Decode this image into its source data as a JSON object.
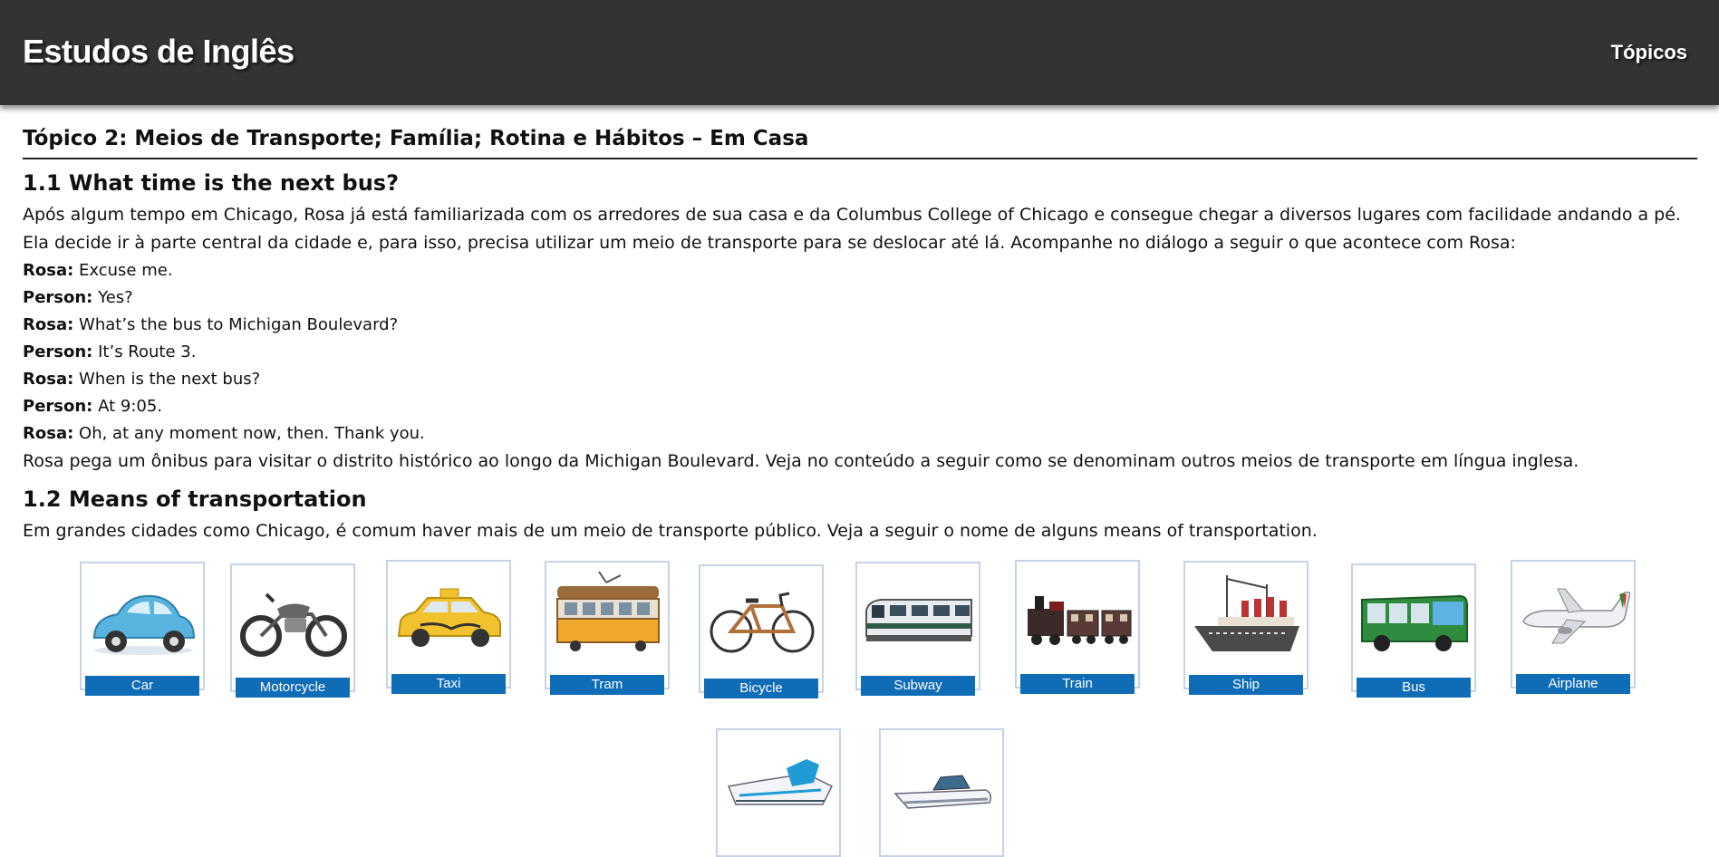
{
  "header": {
    "site_title": "Estudos de Inglês",
    "topics_link": "Tópicos"
  },
  "topic": {
    "title": "Tópico 2: Meios de Transporte; Família; Rotina e Hábitos – Em Casa"
  },
  "section1": {
    "heading": "1.1 What time is the next bus?",
    "intro": "Após algum tempo em Chicago, Rosa já está familiarizada com os arredores de sua casa e da Columbus College of Chicago e consegue chegar a diversos lugares com facilidade andando a pé. Ela decide ir à parte central da cidade e, para isso, precisa utilizar um meio de transporte para se deslocar até lá. Acompanhe no diálogo a seguir o que acontece com Rosa:",
    "dialog": [
      {
        "speaker": "Rosa:",
        "line": "Excuse me."
      },
      {
        "speaker": "Person:",
        "line": "Yes?"
      },
      {
        "speaker": "Rosa:",
        "line": "What’s the bus to Michigan Boulevard?"
      },
      {
        "speaker": "Person:",
        "line": "It’s Route 3."
      },
      {
        "speaker": "Rosa:",
        "line": "When is the next bus?"
      },
      {
        "speaker": "Person:",
        "line": "At 9:05."
      },
      {
        "speaker": "Rosa:",
        "line": "Oh, at any moment now, then. Thank you."
      }
    ],
    "outro": "Rosa pega um ônibus para visitar o distrito histórico ao longo da Michigan Boulevard. Veja no conteúdo a seguir como se denominam outros meios de transporte em língua inglesa."
  },
  "section2": {
    "heading": "1.2 Means of transportation",
    "intro": "Em grandes cidades como Chicago, é comum haver mais de um meio de transporte público. Veja a seguir o nome de alguns means of transportation."
  },
  "transport_cards": [
    {
      "label": "Car",
      "icon": "car-icon"
    },
    {
      "label": "Motorcycle",
      "icon": "motorcycle-icon"
    },
    {
      "label": "Taxi",
      "icon": "taxi-icon"
    },
    {
      "label": "Tram",
      "icon": "tram-icon"
    },
    {
      "label": "Bicycle",
      "icon": "bicycle-icon"
    },
    {
      "label": "Subway",
      "icon": "subway-icon"
    },
    {
      "label": "Train",
      "icon": "train-icon"
    },
    {
      "label": "Ship",
      "icon": "ship-icon"
    },
    {
      "label": "Bus",
      "icon": "bus-icon"
    },
    {
      "label": "Airplane",
      "icon": "airplane-icon"
    },
    {
      "label": "",
      "icon": "ferry-icon"
    },
    {
      "label": "",
      "icon": "speedboat-icon"
    }
  ],
  "colors": {
    "header_bg": "#333333",
    "caption_bg": "#0f6db8",
    "card_border": "#c6d3e6"
  }
}
